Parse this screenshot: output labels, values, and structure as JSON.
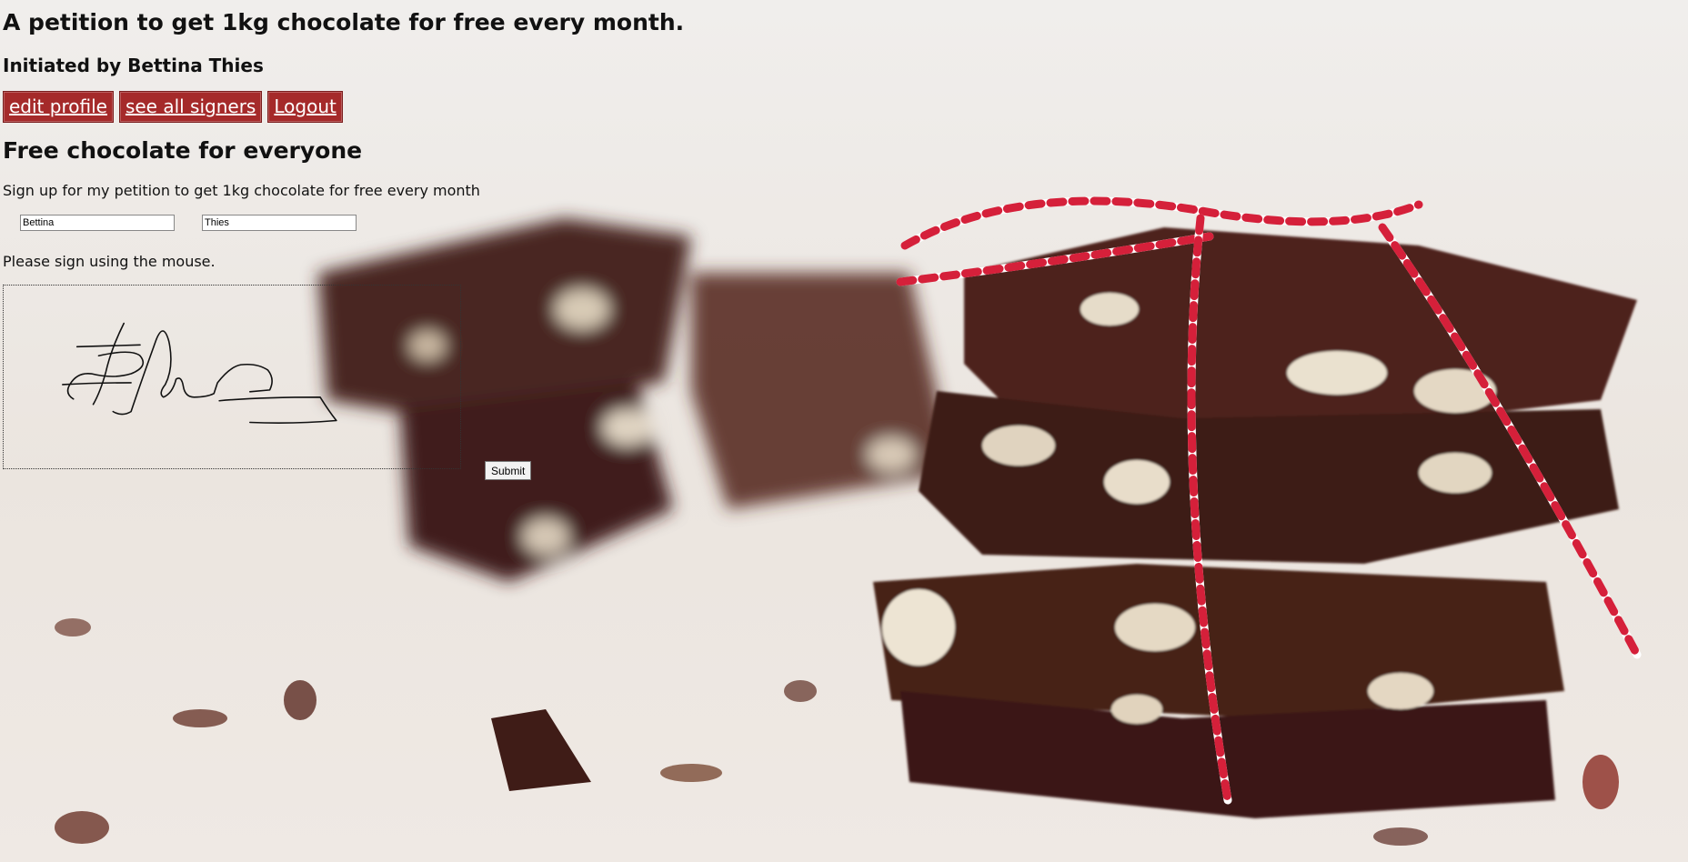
{
  "page": {
    "title": "A petition to get 1kg chocolate for free every month.",
    "initiated_by": "Initiated by Bettina Thies"
  },
  "nav": {
    "edit_profile": "edit profile ",
    "see_all_signers": "see all signers ",
    "logout": "Logout"
  },
  "colors": {
    "button_bg": "#a52a2a",
    "button_text": "#ffffff"
  },
  "petition": {
    "heading": "Free chocolate for everyone",
    "description": "Sign up for my petition to get 1kg chocolate for free every month"
  },
  "form": {
    "first_name": "Bettina",
    "last_name": "Thies",
    "sign_instruction": "Please sign using the mouse.",
    "submit_label": "Submit"
  },
  "background": {
    "subject": "stacked chocolate bark with nuts tied with red and white string"
  }
}
